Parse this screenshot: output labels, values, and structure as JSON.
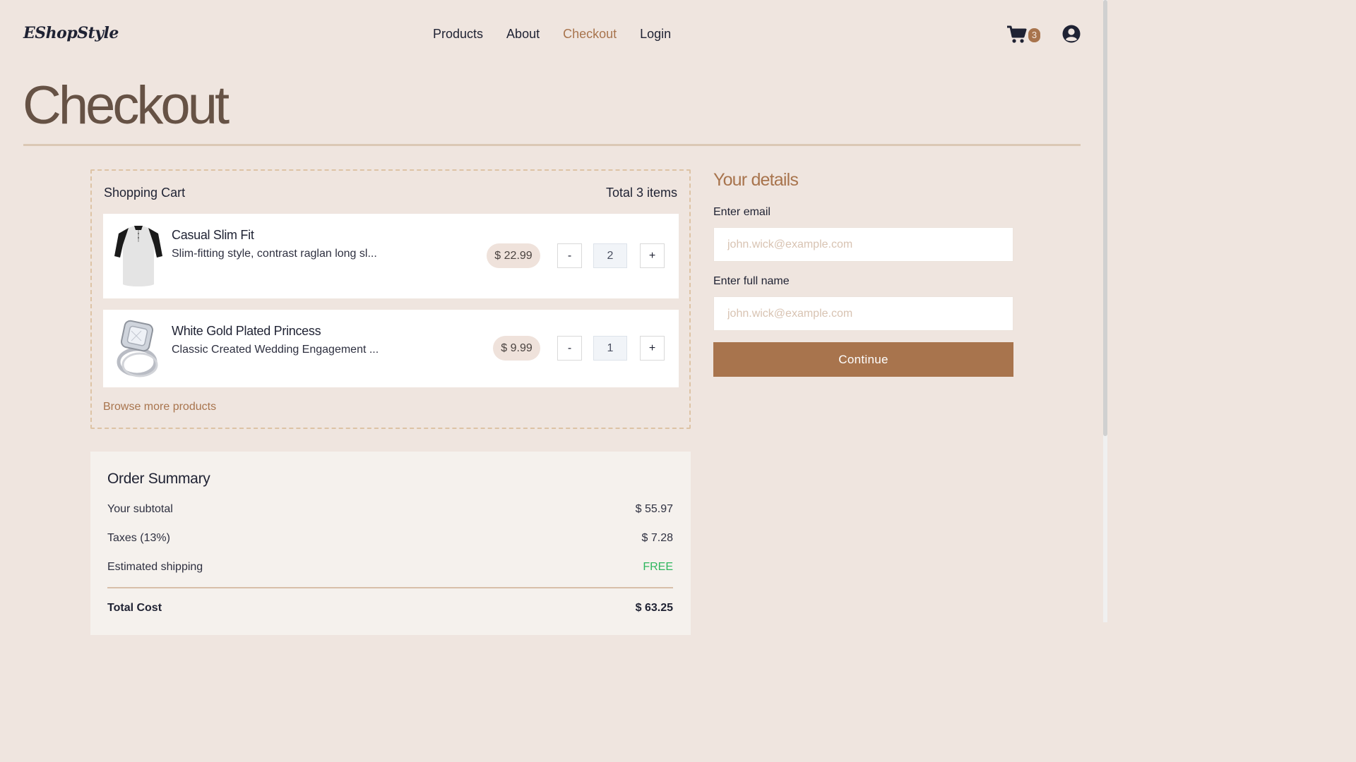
{
  "navbar": {
    "logo": "EShopStyle",
    "links": [
      "Products",
      "About",
      "Checkout",
      "Login"
    ],
    "active_link": "Checkout",
    "cart_count": "3",
    "icons": {
      "cart": "cart-icon",
      "user": "user-circle-icon"
    }
  },
  "page": {
    "title": "Checkout"
  },
  "cart": {
    "title": "Shopping Cart",
    "total_label": "Total 3 items",
    "items": [
      {
        "name": "Casual Slim Fit",
        "description": "Slim-fitting style, contrast raglan long sl...",
        "price": "$ 22.99",
        "quantity": "2",
        "minus": "-",
        "plus": "+"
      },
      {
        "name": "White Gold Plated Princess",
        "description": "Classic Created Wedding Engagement ...",
        "price": "$ 9.99",
        "quantity": "1",
        "minus": "-",
        "plus": "+"
      }
    ],
    "browse_link": "Browse more products"
  },
  "summary": {
    "title": "Order Summary",
    "subtotal_label": "Your subtotal",
    "subtotal": "$ 55.97",
    "taxes_label": "Taxes (13%)",
    "taxes": "$ 7.28",
    "shipping_label": "Estimated shipping",
    "shipping": "FREE",
    "total_label": "Total Cost",
    "total": "$ 63.25"
  },
  "details": {
    "title": "Your details",
    "email_label": "Enter email",
    "email_placeholder": "john.wick@example.com",
    "name_label": "Enter full name",
    "name_placeholder": "john.wick@example.com",
    "continue_label": "Continue"
  },
  "colors": {
    "accent": "#a8744d",
    "background": "#efe5df",
    "free": "#2fb65e",
    "title": "#665245"
  }
}
